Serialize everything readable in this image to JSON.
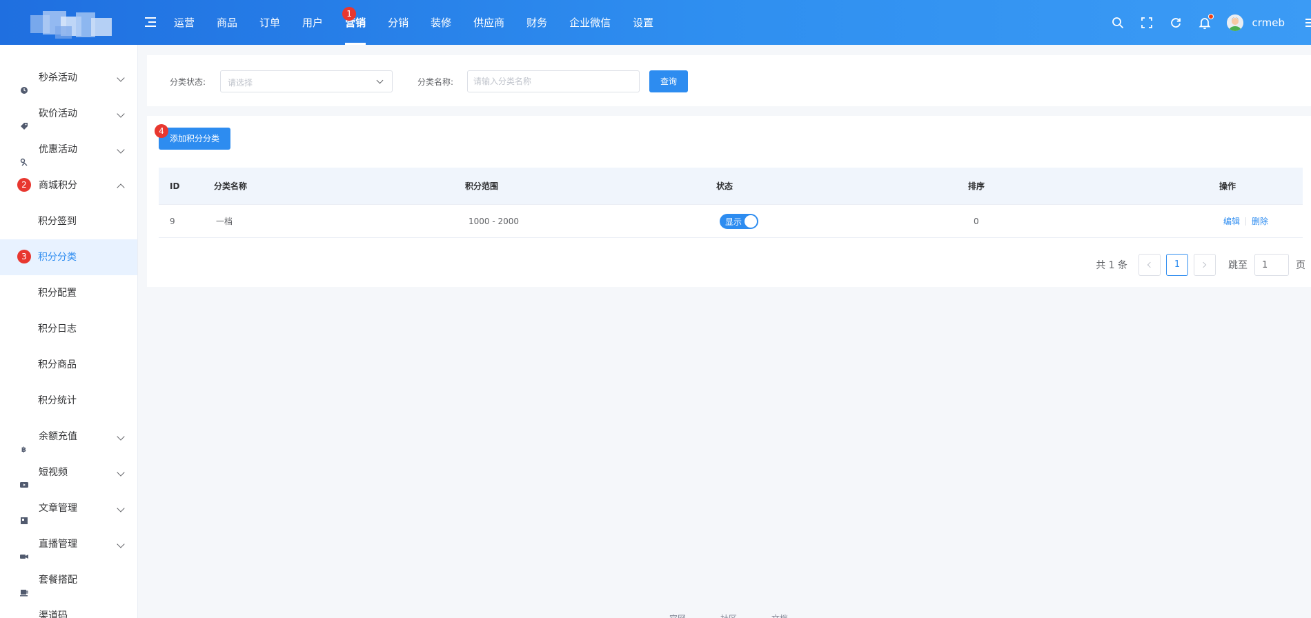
{
  "header": {
    "nav": [
      {
        "label": "运营"
      },
      {
        "label": "商品"
      },
      {
        "label": "订单"
      },
      {
        "label": "用户"
      },
      {
        "label": "营销",
        "active": true,
        "badge": "1"
      },
      {
        "label": "分销"
      },
      {
        "label": "装修"
      },
      {
        "label": "供应商"
      },
      {
        "label": "财务"
      },
      {
        "label": "企业微信"
      },
      {
        "label": "设置"
      }
    ],
    "username": "crmeb",
    "accent": "#2d8cf0"
  },
  "sidebar": {
    "items": [
      {
        "label": "秒杀活动",
        "icon": "clock-icon"
      },
      {
        "label": "砍价活动",
        "icon": "tag-icon"
      },
      {
        "label": "优惠活动",
        "icon": "gift-icon"
      },
      {
        "label": "商城积分",
        "badge": "2",
        "expanded": true
      },
      {
        "label": "积分签到",
        "sub": true
      },
      {
        "label": "积分分类",
        "sub": true,
        "active": true,
        "badge": "3"
      },
      {
        "label": "积分配置",
        "sub": true
      },
      {
        "label": "积分日志",
        "sub": true
      },
      {
        "label": "积分商品",
        "sub": true
      },
      {
        "label": "积分统计",
        "sub": true
      },
      {
        "label": "余额充值",
        "icon": "coin-icon"
      },
      {
        "label": "短视频",
        "icon": "video-icon"
      },
      {
        "label": "文章管理",
        "icon": "article-icon"
      },
      {
        "label": "直播管理",
        "icon": "camera-icon"
      },
      {
        "label": "套餐搭配",
        "icon": "cup-icon"
      },
      {
        "label": "渠道码",
        "icon": "cube-icon"
      }
    ]
  },
  "search": {
    "status_label": "分类状态:",
    "status_placeholder": "请选择",
    "name_label": "分类名称:",
    "name_placeholder": "请输入分类名称",
    "query_button": "查询"
  },
  "toolbar": {
    "add_button": "添加积分分类",
    "add_badge": "4"
  },
  "table": {
    "columns": [
      "ID",
      "分类名称",
      "积分范围",
      "状态",
      "排序",
      "操作"
    ],
    "rows": [
      {
        "id": "9",
        "name": "一档",
        "range": "1000 - 2000",
        "status": "显示",
        "sort": "0",
        "edit": "编辑",
        "delete": "删除"
      }
    ]
  },
  "pagination": {
    "total": "共 1 条",
    "current_page": "1",
    "jump_label": "跳至",
    "jump_value": "1",
    "page_unit": "页"
  },
  "footer": {
    "links": [
      "官网",
      "社区",
      "文档"
    ]
  }
}
